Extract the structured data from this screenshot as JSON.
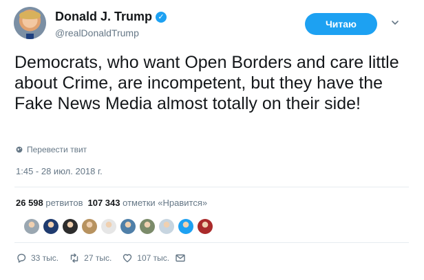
{
  "header": {
    "name": "Donald J. Trump",
    "handle": "@realDonaldTrump",
    "follow_label": "Читаю"
  },
  "tweet": {
    "text": "Democrats, who want Open Borders and care little about Crime, are incompetent, but they have the Fake News Media almost totally on their side!",
    "translate_label": "Перевести твит",
    "timestamp": "1:45 - 28 июл. 2018 г."
  },
  "stats": {
    "retweets_count": "26 598",
    "retweets_label": "ретвитов",
    "likes_count": "107 343",
    "likes_label": "отметки «Нравится»"
  },
  "likers": [
    {
      "name": "liker-1",
      "color": "#9aa7b1"
    },
    {
      "name": "liker-2",
      "color": "#1f3b6f"
    },
    {
      "name": "liker-3",
      "color": "#2d2d2d"
    },
    {
      "name": "liker-4",
      "color": "#b7925f"
    },
    {
      "name": "liker-5",
      "color": "#e6e6e6"
    },
    {
      "name": "liker-6",
      "color": "#4f7fa8"
    },
    {
      "name": "liker-7",
      "color": "#7b8b6a"
    },
    {
      "name": "liker-8",
      "color": "#c7d5e0"
    },
    {
      "name": "liker-9",
      "color": "#1da1f2"
    },
    {
      "name": "liker-10",
      "color": "#aa2b2b"
    }
  ],
  "actions": {
    "replies": "33 тыс.",
    "retweets": "27 тыс.",
    "likes": "107 тыс."
  }
}
